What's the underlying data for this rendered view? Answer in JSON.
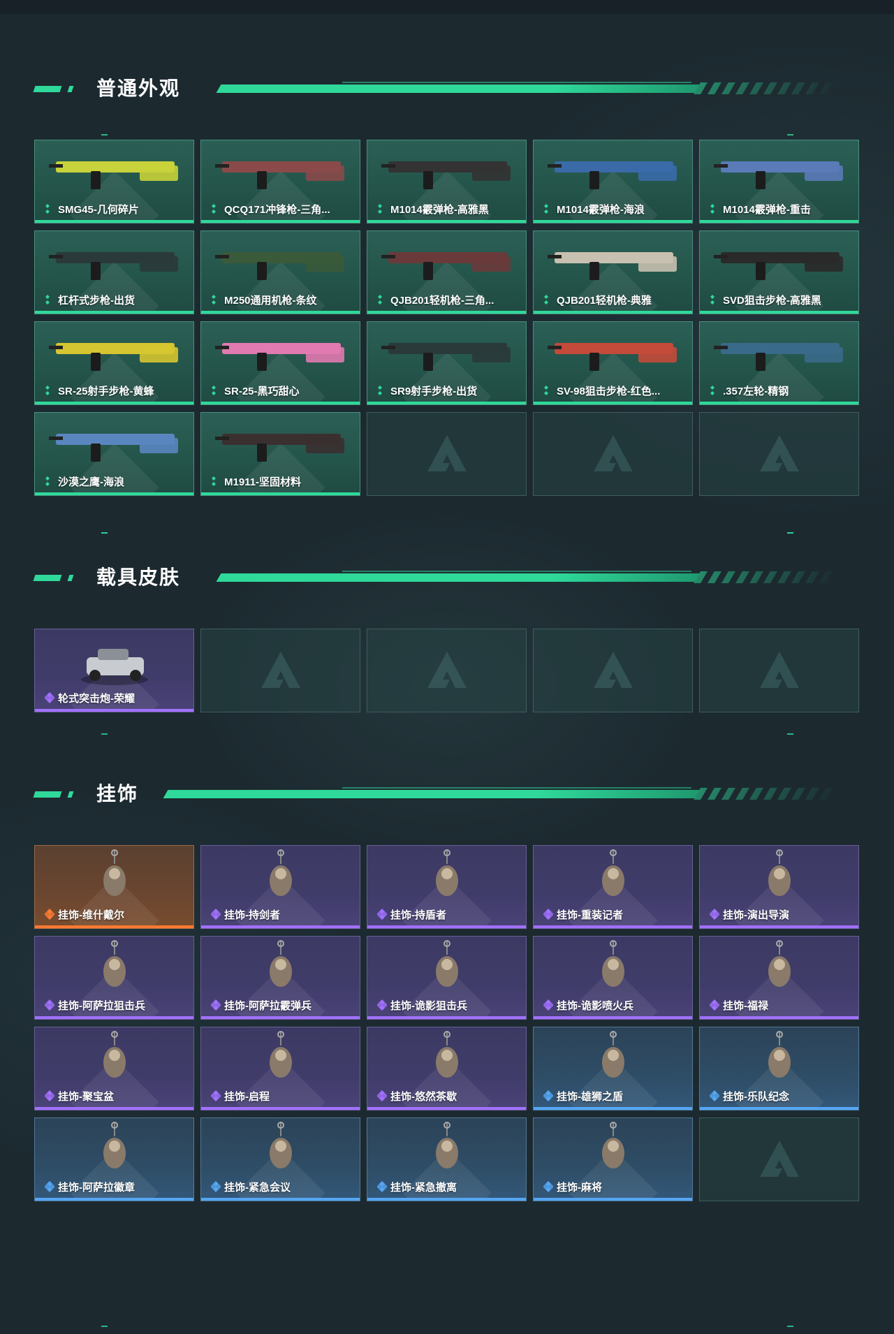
{
  "sections": {
    "weapons": {
      "title": "普通外观",
      "items": [
        {
          "label": "SMG45-几何碎片",
          "rarity": "green"
        },
        {
          "label": "QCQ171冲锋枪-三角...",
          "rarity": "green"
        },
        {
          "label": "M1014霰弹枪-高雅黑",
          "rarity": "green"
        },
        {
          "label": "M1014霰弹枪-海浪",
          "rarity": "green"
        },
        {
          "label": "M1014霰弹枪-重击",
          "rarity": "green"
        },
        {
          "label": "杠杆式步枪-出货",
          "rarity": "green"
        },
        {
          "label": "M250通用机枪-条纹",
          "rarity": "green"
        },
        {
          "label": "QJB201轻机枪-三角...",
          "rarity": "green"
        },
        {
          "label": "QJB201轻机枪-典雅",
          "rarity": "green"
        },
        {
          "label": "SVD狙击步枪-高雅黑",
          "rarity": "green"
        },
        {
          "label": "SR-25射手步枪-黄蜂",
          "rarity": "green"
        },
        {
          "label": "SR-25-黑巧甜心",
          "rarity": "green"
        },
        {
          "label": "SR9射手步枪-出货",
          "rarity": "green"
        },
        {
          "label": "SV-98狙击步枪-红色...",
          "rarity": "green"
        },
        {
          "label": ".357左轮-精钢",
          "rarity": "green"
        },
        {
          "label": "沙漠之鹰-海浪",
          "rarity": "green"
        },
        {
          "label": "M1911-坚固材料",
          "rarity": "green"
        }
      ],
      "empty_slots": 3
    },
    "vehicles": {
      "title": "载具皮肤",
      "items": [
        {
          "label": "轮式突击炮-荣耀",
          "rarity": "purple"
        }
      ],
      "empty_slots": 4
    },
    "charms": {
      "title": "挂饰",
      "items": [
        {
          "label": "挂饰-维什戴尔",
          "rarity": "orange"
        },
        {
          "label": "挂饰-持剑者",
          "rarity": "purple"
        },
        {
          "label": "挂饰-持盾者",
          "rarity": "purple"
        },
        {
          "label": "挂饰-重装记者",
          "rarity": "purple"
        },
        {
          "label": "挂饰-演出导演",
          "rarity": "purple"
        },
        {
          "label": "挂饰-阿萨拉狙击兵",
          "rarity": "purple"
        },
        {
          "label": "挂饰-阿萨拉霰弹兵",
          "rarity": "purple"
        },
        {
          "label": "挂饰-诡影狙击兵",
          "rarity": "purple"
        },
        {
          "label": "挂饰-诡影喷火兵",
          "rarity": "purple"
        },
        {
          "label": "挂饰-福禄",
          "rarity": "purple"
        },
        {
          "label": "挂饰-聚宝盆",
          "rarity": "purple"
        },
        {
          "label": "挂饰-启程",
          "rarity": "purple"
        },
        {
          "label": "挂饰-悠然茶歇",
          "rarity": "purple"
        },
        {
          "label": "挂饰-雄狮之盾",
          "rarity": "blue"
        },
        {
          "label": "挂饰-乐队纪念",
          "rarity": "blue"
        },
        {
          "label": "挂饰-阿萨拉徽章",
          "rarity": "blue"
        },
        {
          "label": "挂饰-紧急会议",
          "rarity": "blue"
        },
        {
          "label": "挂饰-紧急撤离",
          "rarity": "blue"
        },
        {
          "label": "挂饰-麻将",
          "rarity": "blue"
        }
      ],
      "empty_slots": 1
    }
  },
  "colors": {
    "accent": "#2fd99a",
    "rarity_green": "#2fd99a",
    "rarity_purple": "#a171ff",
    "rarity_blue": "#55a6f2",
    "rarity_orange": "#ff7a33"
  }
}
